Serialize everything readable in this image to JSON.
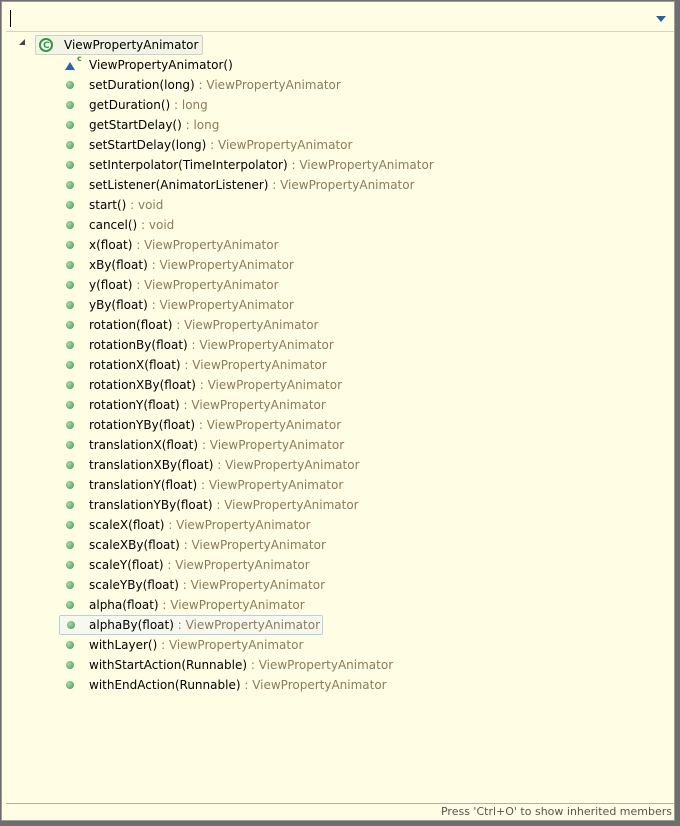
{
  "filter": {
    "value": ""
  },
  "class_node": {
    "label": "ViewPropertyAnimator",
    "icon": "class-icon"
  },
  "constructor": {
    "name": "ViewPropertyAnimator()",
    "icon": "constructor-icon"
  },
  "methods": [
    {
      "name": "setDuration(long)",
      "ret": "ViewPropertyAnimator"
    },
    {
      "name": "getDuration()",
      "ret": "long"
    },
    {
      "name": "getStartDelay()",
      "ret": "long"
    },
    {
      "name": "setStartDelay(long)",
      "ret": "ViewPropertyAnimator"
    },
    {
      "name": "setInterpolator(TimeInterpolator)",
      "ret": "ViewPropertyAnimator"
    },
    {
      "name": "setListener(AnimatorListener)",
      "ret": "ViewPropertyAnimator"
    },
    {
      "name": "start()",
      "ret": "void"
    },
    {
      "name": "cancel()",
      "ret": "void"
    },
    {
      "name": "x(float)",
      "ret": "ViewPropertyAnimator"
    },
    {
      "name": "xBy(float)",
      "ret": "ViewPropertyAnimator"
    },
    {
      "name": "y(float)",
      "ret": "ViewPropertyAnimator"
    },
    {
      "name": "yBy(float)",
      "ret": "ViewPropertyAnimator"
    },
    {
      "name": "rotation(float)",
      "ret": "ViewPropertyAnimator"
    },
    {
      "name": "rotationBy(float)",
      "ret": "ViewPropertyAnimator"
    },
    {
      "name": "rotationX(float)",
      "ret": "ViewPropertyAnimator"
    },
    {
      "name": "rotationXBy(float)",
      "ret": "ViewPropertyAnimator"
    },
    {
      "name": "rotationY(float)",
      "ret": "ViewPropertyAnimator"
    },
    {
      "name": "rotationYBy(float)",
      "ret": "ViewPropertyAnimator"
    },
    {
      "name": "translationX(float)",
      "ret": "ViewPropertyAnimator"
    },
    {
      "name": "translationXBy(float)",
      "ret": "ViewPropertyAnimator"
    },
    {
      "name": "translationY(float)",
      "ret": "ViewPropertyAnimator"
    },
    {
      "name": "translationYBy(float)",
      "ret": "ViewPropertyAnimator"
    },
    {
      "name": "scaleX(float)",
      "ret": "ViewPropertyAnimator"
    },
    {
      "name": "scaleXBy(float)",
      "ret": "ViewPropertyAnimator"
    },
    {
      "name": "scaleY(float)",
      "ret": "ViewPropertyAnimator"
    },
    {
      "name": "scaleYBy(float)",
      "ret": "ViewPropertyAnimator"
    },
    {
      "name": "alpha(float)",
      "ret": "ViewPropertyAnimator"
    },
    {
      "name": "alphaBy(float)",
      "ret": "ViewPropertyAnimator",
      "selected": true
    },
    {
      "name": "withLayer()",
      "ret": "ViewPropertyAnimator"
    },
    {
      "name": "withStartAction(Runnable)",
      "ret": "ViewPropertyAnimator"
    },
    {
      "name": "withEndAction(Runnable)",
      "ret": "ViewPropertyAnimator"
    }
  ],
  "separator": " : ",
  "status": "Press 'Ctrl+O' to show inherited members"
}
